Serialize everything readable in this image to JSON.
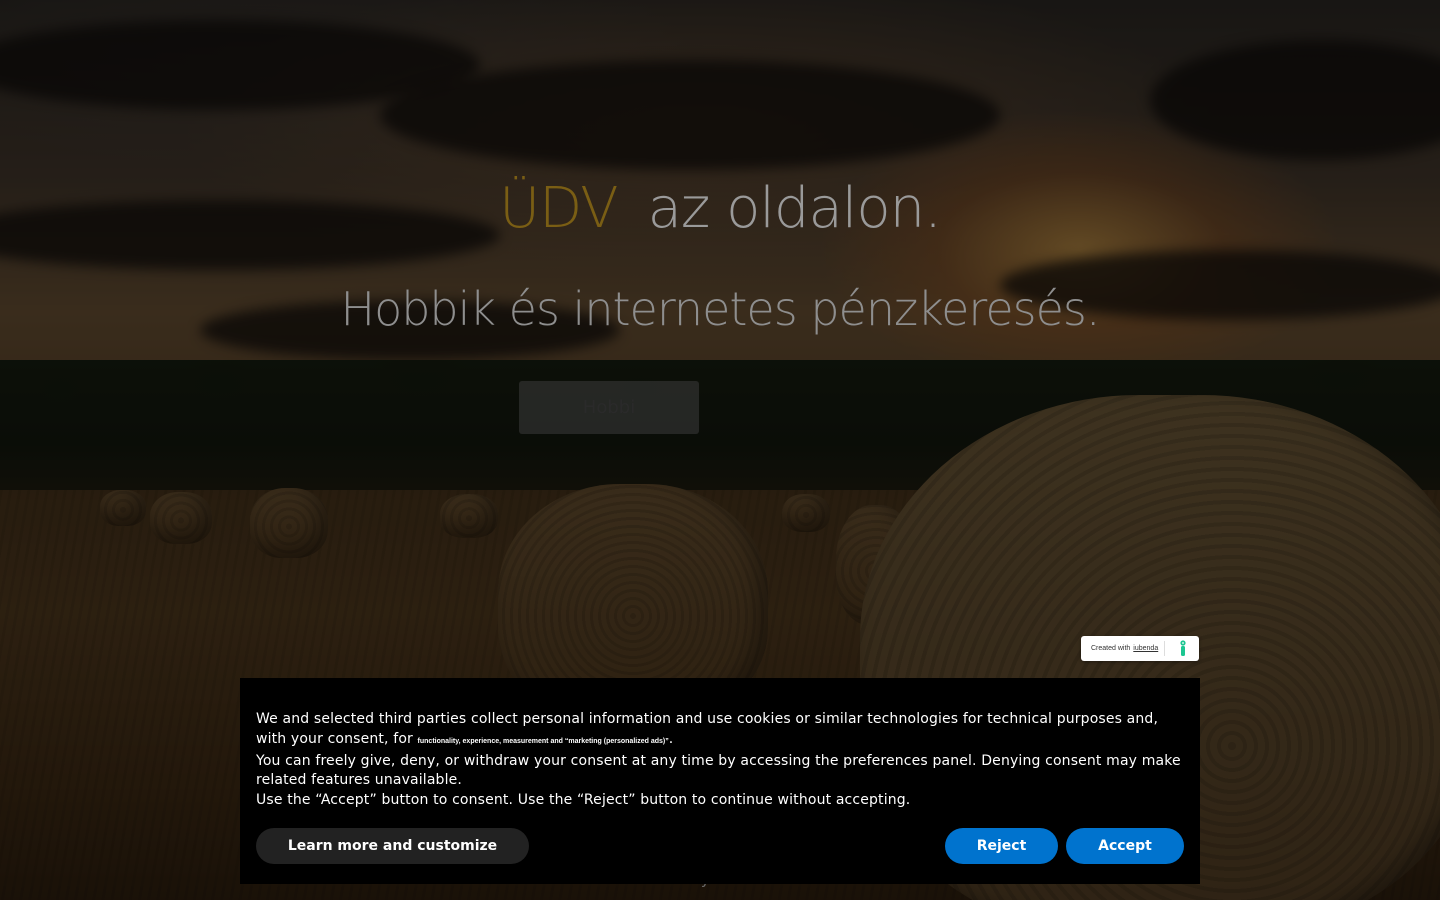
{
  "hero": {
    "title_accent": "ÜDV",
    "title_rest": "az oldalon.",
    "subtitle": "Hobbik és internetes pénzkeresés.",
    "button_label": "Hobbi"
  },
  "footer": {
    "copyright": "© Tbandy 2020 - 2020"
  },
  "iubenda_badge": {
    "created_with": "Created with",
    "brand": "iubenda"
  },
  "cookie_banner": {
    "line1_before": "We and selected third parties collect personal information and use cookies or similar technologies for technical purposes and, with your consent, for ",
    "purposes": "functionality, experience, measurement and “marketing (personalized ads)”",
    "line1_after": ".",
    "line2": "You can freely give, deny, or withdraw your consent at any time by accessing the preferences panel. Denying consent may make related features unavailable.",
    "line3": "Use the “Accept” button to consent. Use the “Reject” button to continue without accepting.",
    "learn_more_label": "Learn more and customize",
    "reject_label": "Reject",
    "accept_label": "Accept"
  },
  "colors": {
    "banner_bg": "#000000",
    "primary_button": "#0073ce",
    "secondary_button": "#222222",
    "title_accent": "#7a5e14"
  }
}
